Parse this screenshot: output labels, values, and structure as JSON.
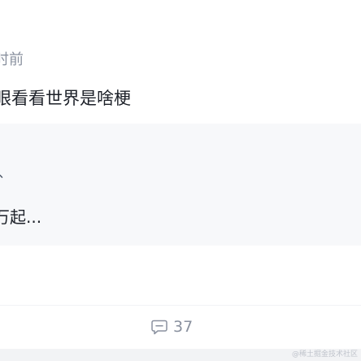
{
  "post": {
    "timestamp": "时前",
    "text": "眼看看世界是啥梗",
    "quote": {
      "mark": "、",
      "text": "万起..."
    },
    "actions": {
      "comment_count": "37",
      "comment_icon": "comment-icon"
    }
  },
  "watermark": "@稀土掘金技术社区",
  "colors": {
    "text_primary": "#1d2129",
    "text_secondary": "#8a919f",
    "card_background": "#f7f8fa",
    "divider": "#f2f3f5"
  }
}
